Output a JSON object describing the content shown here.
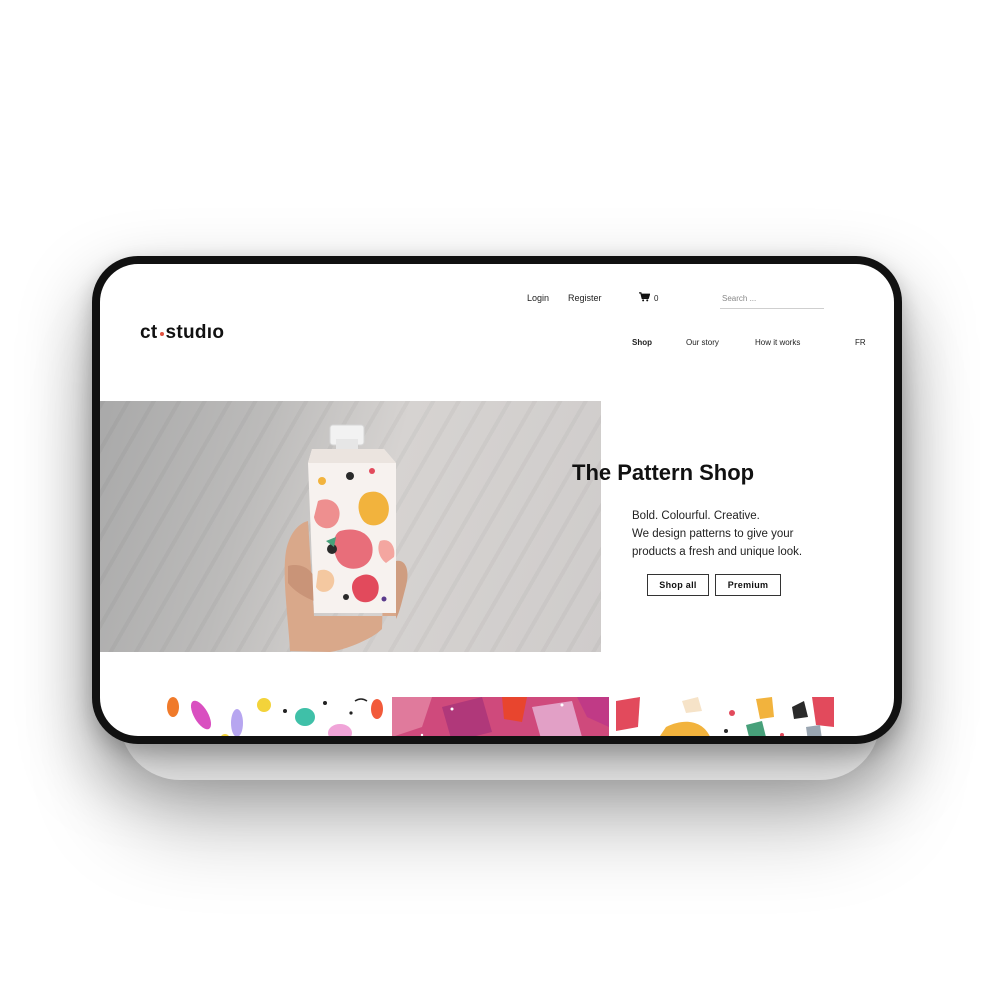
{
  "header": {
    "login_label": "Login",
    "register_label": "Register",
    "cart_count": "0",
    "search_placeholder": "Search ..."
  },
  "brand": {
    "logo_left": "ct",
    "logo_right": "studıo",
    "dot_color": "#e0503e"
  },
  "nav": {
    "items": [
      {
        "label": "Shop",
        "active": true
      },
      {
        "label": "Our story",
        "active": false
      },
      {
        "label": "How it works",
        "active": false
      }
    ],
    "language": "FR"
  },
  "hero": {
    "title": "The Pattern Shop",
    "tagline": [
      "Bold. Colourful. Creative.",
      "We design patterns to give your",
      "products a fresh and unique look."
    ],
    "buttons": {
      "shop_all": "Shop all",
      "premium": "Premium"
    },
    "image": "hand-holding-patterned-carton-image"
  },
  "patterns": {
    "tiles": [
      "watercolor-splash-pattern",
      "pink-abstract-pattern",
      "terrazzo-pattern"
    ]
  }
}
